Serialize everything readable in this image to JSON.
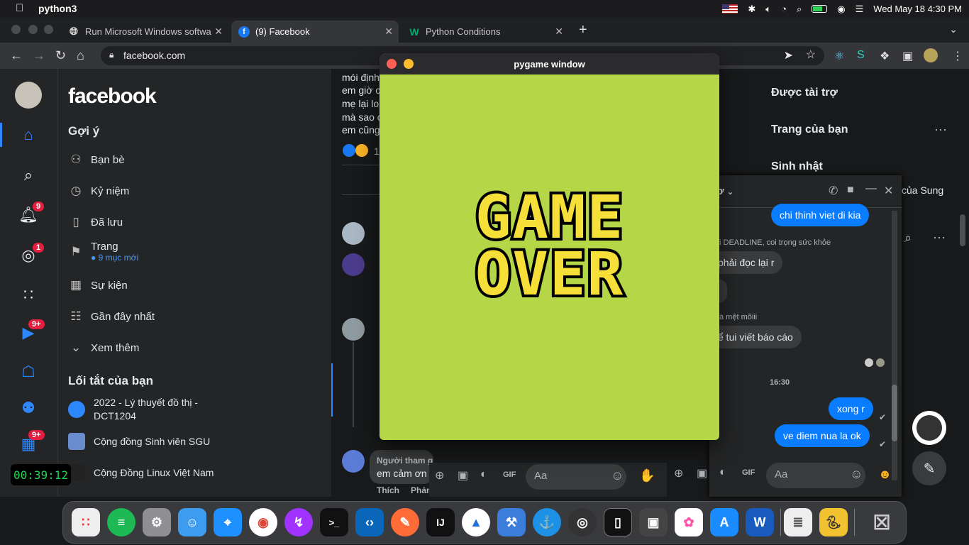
{
  "menubar": {
    "app": "python3",
    "datetime": "Wed May 18  4:30 PM"
  },
  "tabs": [
    {
      "label": "Run Microsoft Windows softwa",
      "icon": "globe-icon"
    },
    {
      "label": "(9) Facebook",
      "icon": "facebook-icon"
    },
    {
      "label": "Python Conditions",
      "icon": "w3schools-icon"
    }
  ],
  "address": {
    "url": "facebook.com"
  },
  "fb_sidebar": {
    "notif_badge": "9",
    "messenger_badge": "1",
    "watch_badge": "9+",
    "gaming_badge": "9+"
  },
  "fb_nav": {
    "logo": "facebook",
    "suggest_title": "Gợi ý",
    "items": [
      {
        "label": "Bạn bè",
        "icon": "friends-icon"
      },
      {
        "label": "Kỷ niệm",
        "icon": "clock-icon"
      },
      {
        "label": "Đã lưu",
        "icon": "bookmark-icon"
      },
      {
        "label": "Trang",
        "icon": "flag-icon",
        "sub": "9 mục mới"
      },
      {
        "label": "Sự kiện",
        "icon": "calendar-icon"
      },
      {
        "label": "Gần đây nhất",
        "icon": "rss-icon"
      },
      {
        "label": "Xem thêm",
        "icon": "chevron-down-icon"
      }
    ],
    "shortcuts_title": "Lối tắt của bạn",
    "shortcuts": [
      "2022 - Lý thuyết đồ thị - DCT1204",
      "Cộng đồng Sinh viên SGU",
      "Cộng Đồng Linux Việt Nam"
    ]
  },
  "timer": "00:39:12",
  "feed": {
    "post_lines": [
      "mói định",
      "em giờ c",
      "mẹ lại lo",
      "mà sao c",
      "em cũng"
    ],
    "reaction_count": "1",
    "comment_author": "Người tham g",
    "comment_text": "em cảm ơn",
    "like": "Thích",
    "reply": "Phản"
  },
  "right": {
    "sponsored": "Được tài trợ",
    "your_pages": "Trang của bạn",
    "birthday": "Sinh nhật",
    "birthday_name": "của Sung"
  },
  "chat": {
    "title": "ơ",
    "messages": [
      {
        "text": "chi thinh viet di kia",
        "me": true
      },
      {
        "caption": "i DEADLINE, coi trọng sức khỏe"
      },
      {
        "text": "phải đọc lại r",
        "me": false
      },
      {
        "caption": "à mệt mõiii"
      },
      {
        "text": "ể tui viết báo cáo",
        "me": false
      },
      {
        "caption": "16:30"
      },
      {
        "text": "xong r",
        "me": true
      },
      {
        "text": "ve diem nua la ok",
        "me": true
      }
    ],
    "input_placeholder": "Aa"
  },
  "pygame": {
    "title": "pygame window",
    "line1": "GAME",
    "line2": "OVER",
    "bg": "#b5d646",
    "text_color": "#f7df39"
  },
  "colors": {
    "fb_blue": "#2d88ff",
    "badge_red": "#e41e3f",
    "messenger_blue": "#0a7cff"
  },
  "dock": [
    "launchpad",
    "spotify",
    "settings",
    "finder",
    "safari",
    "chrome",
    "messenger",
    "terminal",
    "vscode",
    "postman",
    "intellij",
    "xcode-tools",
    "instruments",
    "docker",
    "obs",
    "iphone-mirror",
    "screenshot",
    "photos",
    "app-store",
    "word",
    "textedit",
    "python",
    "trash"
  ]
}
